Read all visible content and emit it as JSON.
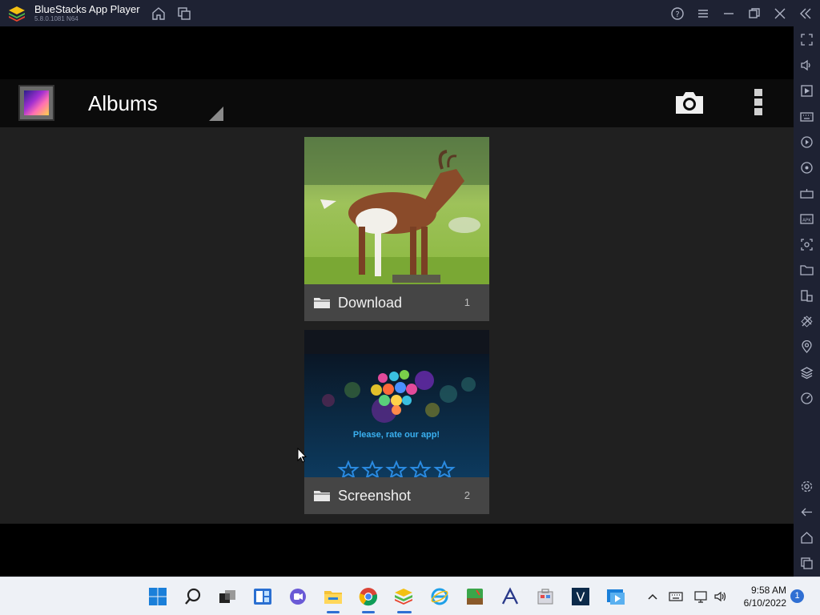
{
  "window": {
    "title": "BlueStacks App Player",
    "version": "5.8.0.1081 N64"
  },
  "actionbar": {
    "title": "Albums"
  },
  "albums": [
    {
      "name": "Download",
      "count": "1"
    },
    {
      "name": "Screenshot",
      "count": "2"
    }
  ],
  "screenshot_thumb": {
    "text": "Please, rate our app!"
  },
  "taskbar": {
    "time": "9:58 AM",
    "date": "6/10/2022",
    "notifications": "1"
  },
  "colors": {
    "titlebar": "#1e2233",
    "accent": "#2f6fd3",
    "content_bg": "#202020"
  }
}
